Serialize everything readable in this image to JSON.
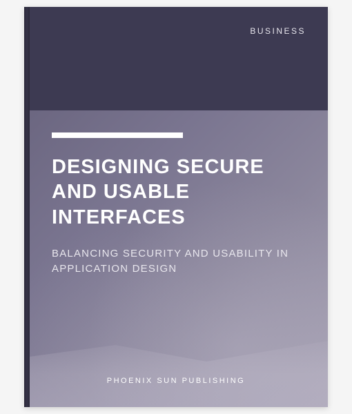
{
  "cover": {
    "category": "BUSINESS",
    "title": "DESIGNING SECURE AND USABLE INTERFACES",
    "subtitle": "BALANCING SECURITY AND USABILITY IN APPLICATION DESIGN",
    "publisher": "PHOENIX SUN PUBLISHING"
  }
}
